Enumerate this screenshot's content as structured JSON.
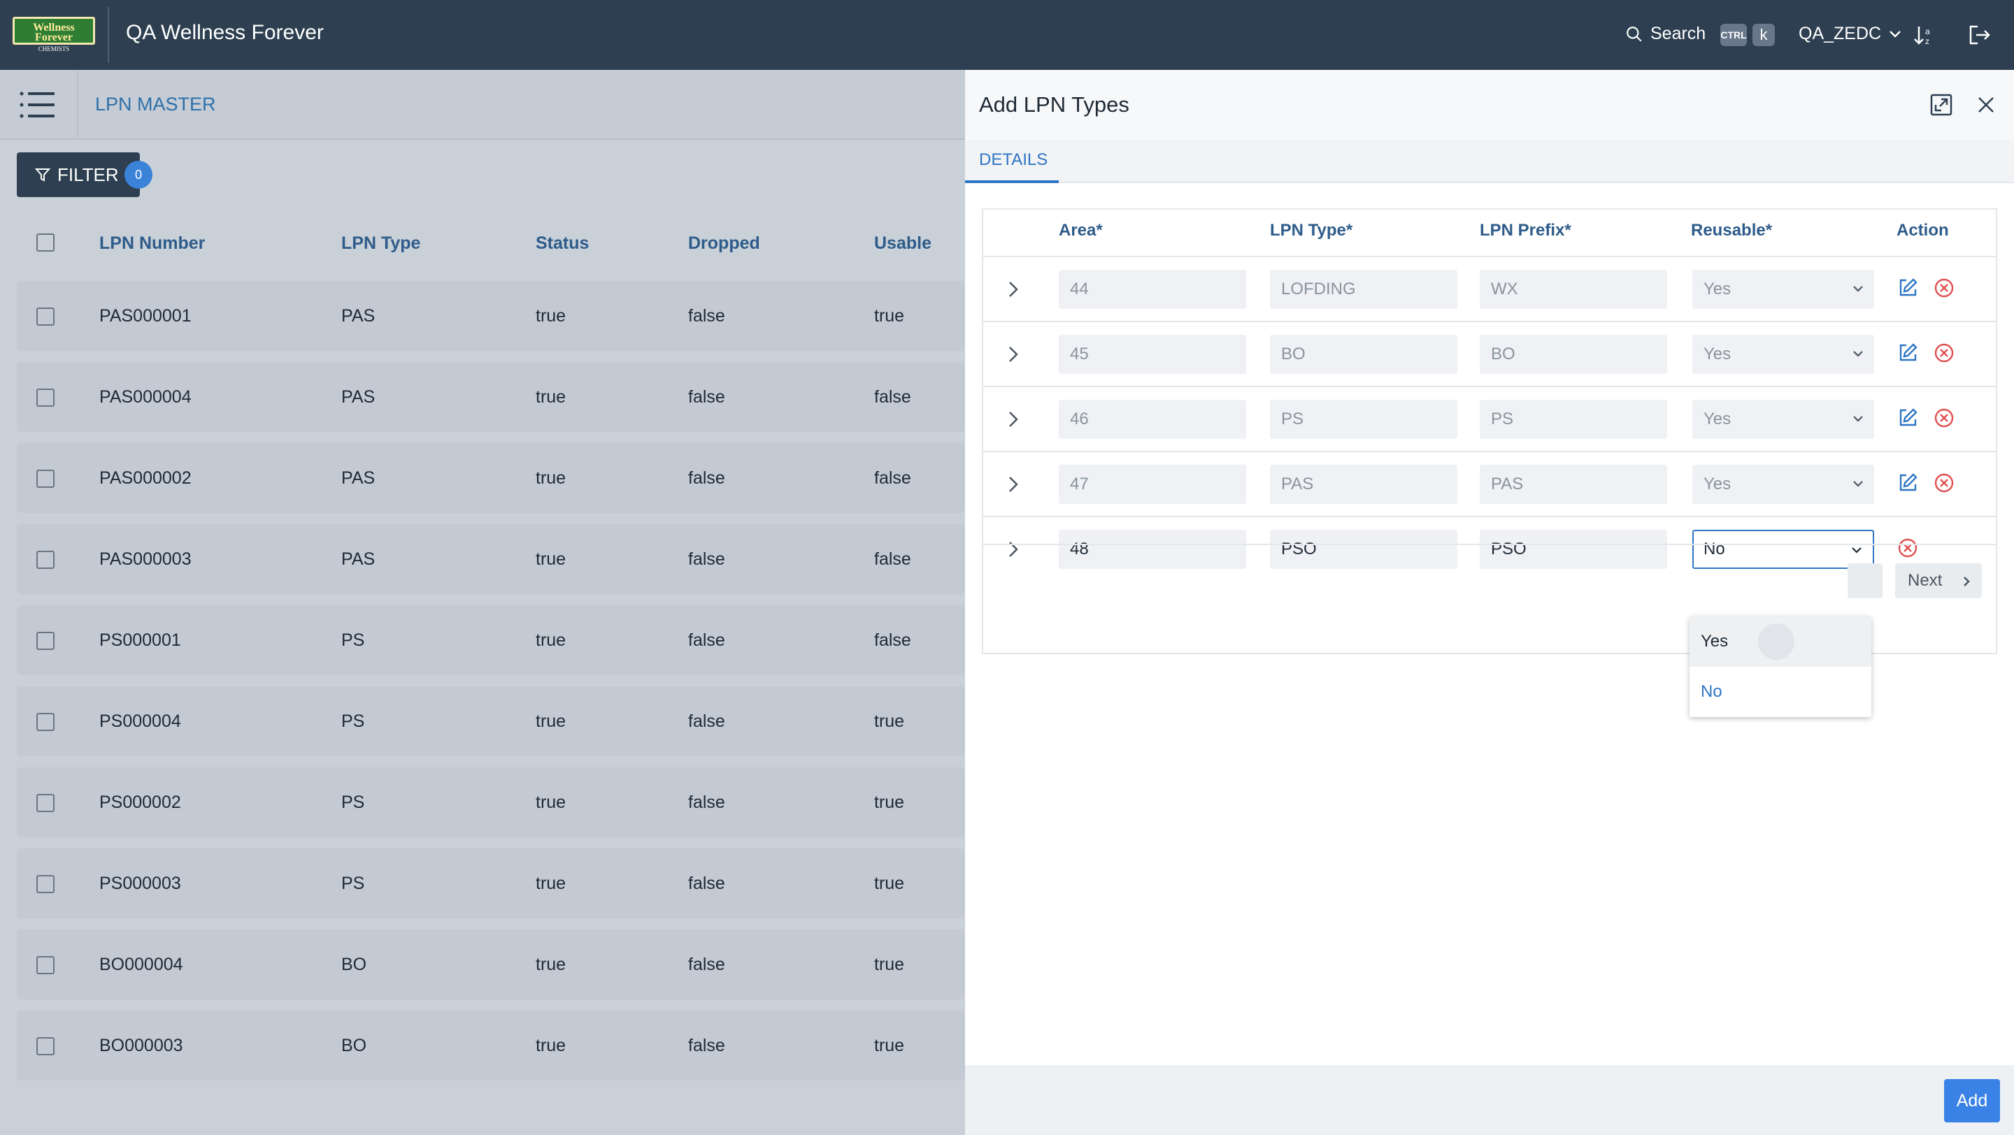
{
  "header": {
    "logo_text": "Wellness Forever",
    "logo_sub": "CHEMISTS",
    "app_title": "QA Wellness Forever",
    "search_label": "Search",
    "kbd_ctrl": "CTRL",
    "kbd_key": "k",
    "user": "QA_ZEDC"
  },
  "page": {
    "title": "LPN MASTER",
    "filter_label": "FILTER",
    "filter_count": "0",
    "columns": [
      "LPN Number",
      "LPN Type",
      "Status",
      "Dropped",
      "Usable"
    ],
    "rows": [
      [
        "PAS000001",
        "PAS",
        "true",
        "false",
        "true"
      ],
      [
        "PAS000004",
        "PAS",
        "true",
        "false",
        "false"
      ],
      [
        "PAS000002",
        "PAS",
        "true",
        "false",
        "false"
      ],
      [
        "PAS000003",
        "PAS",
        "true",
        "false",
        "false"
      ],
      [
        "PS000001",
        "PS",
        "true",
        "false",
        "false"
      ],
      [
        "PS000004",
        "PS",
        "true",
        "false",
        "true"
      ],
      [
        "PS000002",
        "PS",
        "true",
        "false",
        "true"
      ],
      [
        "PS000003",
        "PS",
        "true",
        "false",
        "true"
      ],
      [
        "BO000004",
        "BO",
        "true",
        "false",
        "true"
      ],
      [
        "BO000003",
        "BO",
        "true",
        "false",
        "true"
      ]
    ]
  },
  "drawer": {
    "title": "Add LPN Types",
    "tab": "DETAILS",
    "columns": [
      "Area*",
      "LPN Type*",
      "LPN Prefix*",
      "Reusable*",
      "Action"
    ],
    "rows": [
      {
        "area": "44",
        "type": "LOFDING",
        "prefix": "WX",
        "reusable": "Yes"
      },
      {
        "area": "45",
        "type": "BO",
        "prefix": "BO",
        "reusable": "Yes"
      },
      {
        "area": "46",
        "type": "PS",
        "prefix": "PS",
        "reusable": "Yes"
      },
      {
        "area": "47",
        "type": "PAS",
        "prefix": "PAS",
        "reusable": "Yes"
      },
      {
        "area": "48",
        "type": "PSO",
        "prefix": "PSO",
        "reusable": "No"
      }
    ],
    "dropdown_options": [
      "Yes",
      "No"
    ],
    "next_label": "Next",
    "add_label": "Add"
  }
}
